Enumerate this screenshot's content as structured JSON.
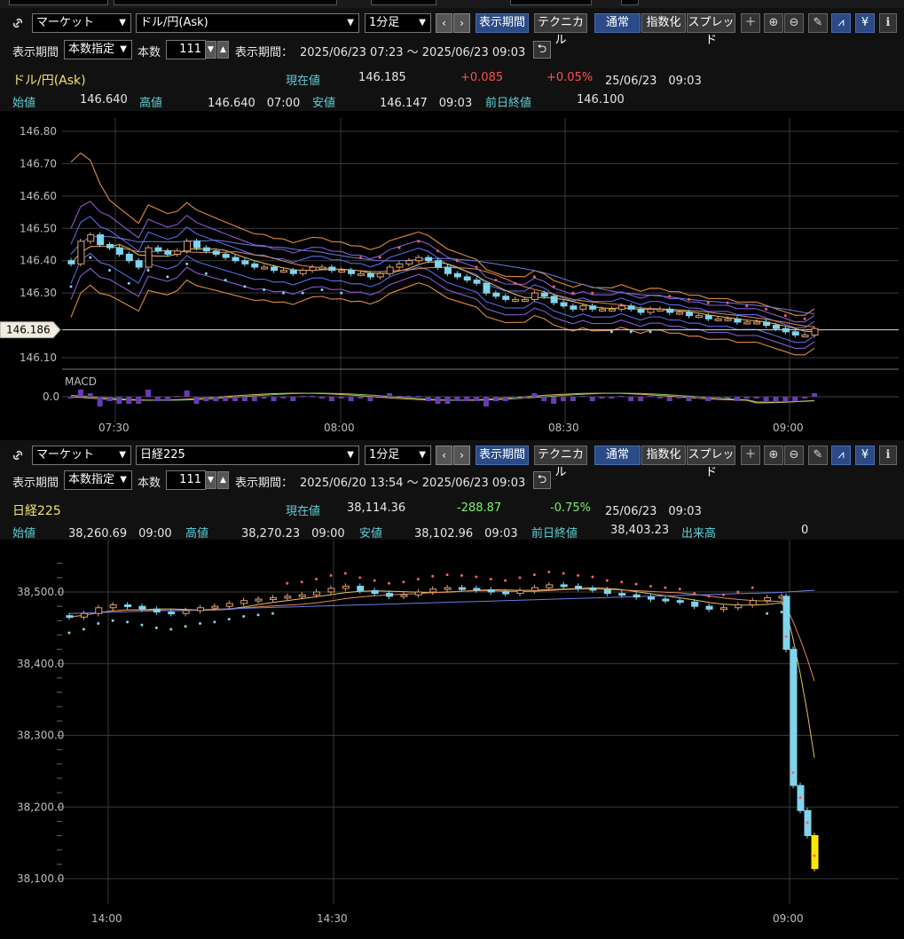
{
  "panel1": {
    "link_icon": "link-icon",
    "market": "マーケット",
    "symbol": "ドル/円(Ask)",
    "timeframe": "1分足",
    "prev": "‹",
    "next": "›",
    "btn_period": "表示期間",
    "btn_technical": "テクニカル",
    "btn_normal": "通常",
    "btn_index": "指数化",
    "btn_spread": "スプレッド",
    "period_label": "表示期間",
    "period_mode": "本数指定",
    "count_label": "本数",
    "count_value": "111",
    "range_label": "表示期間：",
    "range_value": "2025/06/23 07:23 ～ 2025/06/23 09:03",
    "name": "ドル/円(Ask)",
    "current_label": "現在値",
    "current_value": "146.185",
    "change": "+0.085",
    "change_pct": "+0.05%",
    "datetime": "25/06/23　09:03",
    "open_label": "始値",
    "open_value": "146.640",
    "high_label": "高値",
    "high_value": "146.640　07:00",
    "low_label": "安値",
    "low_value": "146.147　09:03",
    "prev_close_label": "前日終値",
    "prev_close_value": "146.100",
    "price_tag": "146.186",
    "macd_label": "MACD",
    "macd_zero": "0.0"
  },
  "panel2": {
    "market": "マーケット",
    "symbol": "日経225",
    "timeframe": "1分足",
    "prev": "‹",
    "next": "›",
    "btn_period": "表示期間",
    "btn_technical": "テクニカル",
    "btn_normal": "通常",
    "btn_index": "指数化",
    "btn_spread": "スプレッド",
    "period_label": "表示期間",
    "period_mode": "本数指定",
    "count_label": "本数",
    "count_value": "111",
    "range_label": "表示期間：",
    "range_value": "2025/06/20 13:54 ～ 2025/06/23 09:03",
    "name": "日経225",
    "current_label": "現在値",
    "current_value": "38,114.36",
    "change": "-288.87",
    "change_pct": "-0.75%",
    "datetime": "25/06/23　09:03",
    "open_label": "始値",
    "open_value": "38,260.69　09:00",
    "high_label": "高値",
    "high_value": "38,270.23　09:00",
    "low_label": "安値",
    "low_value": "38,102.96　09:03",
    "prev_close_label": "前日終値",
    "prev_close_value": "38,403.23",
    "volume_label": "出来高",
    "volume_value": "0"
  },
  "toolbar_icons": [
    "plus-icon",
    "zoom-in-icon",
    "zoom-out-icon",
    "pencil-icon",
    "chart-select-icon",
    "yen-icon",
    "info-icon"
  ],
  "chart_data": [
    {
      "type": "candlestick",
      "title": "ドル/円(Ask)",
      "y_ticks": [
        "146.80",
        "146.70",
        "146.60",
        "146.50",
        "146.40",
        "146.30",
        "146.10"
      ],
      "ylim": [
        146.08,
        146.82
      ],
      "x_ticks": [
        "07:30",
        "08:00",
        "08:30",
        "09:00"
      ],
      "last_price": 146.186,
      "close_series": [
        146.39,
        146.46,
        146.48,
        146.45,
        146.44,
        146.42,
        146.4,
        146.38,
        146.44,
        146.43,
        146.42,
        146.43,
        146.46,
        146.44,
        146.43,
        146.42,
        146.41,
        146.4,
        146.39,
        146.38,
        146.38,
        146.37,
        146.37,
        146.36,
        146.37,
        146.38,
        146.38,
        146.37,
        146.37,
        146.36,
        146.36,
        146.35,
        146.36,
        146.38,
        146.39,
        146.4,
        146.41,
        146.4,
        146.38,
        146.36,
        146.35,
        146.34,
        146.33,
        146.3,
        146.29,
        146.28,
        146.28,
        146.28,
        146.3,
        146.29,
        146.27,
        146.26,
        146.25,
        146.26,
        146.25,
        146.25,
        146.25,
        146.26,
        146.25,
        146.24,
        146.25,
        146.25,
        146.24,
        146.24,
        146.23,
        146.23,
        146.22,
        146.22,
        146.22,
        146.21,
        146.21,
        146.21,
        146.2,
        146.19,
        146.18,
        146.17,
        146.17,
        146.19
      ],
      "macd_zero": 0.0
    },
    {
      "type": "candlestick",
      "title": "日経225",
      "y_ticks": [
        "38,500.0",
        "38,400.0",
        "38,300.0",
        "38,200.0",
        "38,100.0"
      ],
      "ylim": [
        38085,
        38560
      ],
      "x_ticks": [
        "14:00",
        "14:30",
        "09:00"
      ],
      "close_series": [
        38465,
        38470,
        38478,
        38482,
        38480,
        38476,
        38472,
        38470,
        38474,
        38478,
        38480,
        38484,
        38488,
        38490,
        38492,
        38494,
        38496,
        38500,
        38505,
        38508,
        38502,
        38498,
        38494,
        38496,
        38500,
        38504,
        38506,
        38505,
        38503,
        38500,
        38498,
        38502,
        38506,
        38510,
        38508,
        38505,
        38503,
        38498,
        38496,
        38493,
        38490,
        38488,
        38486,
        38480,
        38476,
        38478,
        38482,
        38488,
        38492,
        38494,
        38420,
        38230,
        38195,
        38160,
        38114
      ]
    }
  ]
}
